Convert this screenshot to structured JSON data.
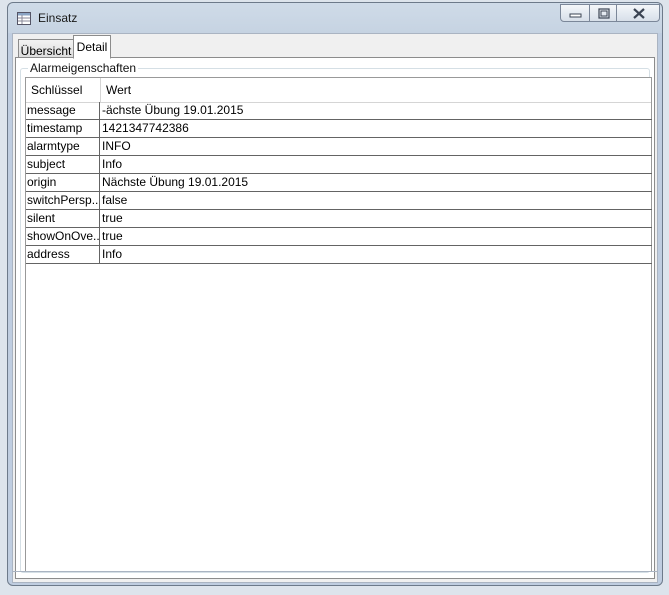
{
  "window": {
    "title": "Einsatz"
  },
  "tabs": [
    {
      "label": "Übersicht"
    },
    {
      "label": "Detail"
    }
  ],
  "group": {
    "label": "Alarmeigenschaften"
  },
  "table": {
    "columns": [
      "Schlüssel",
      "Wert"
    ],
    "rows": [
      {
        "key": "message",
        "value": "-ächste Übung 19.01.2015"
      },
      {
        "key": "timestamp",
        "value": "1421347742386"
      },
      {
        "key": "alarmtype",
        "value": "INFO"
      },
      {
        "key": "subject",
        "value": "Info"
      },
      {
        "key": "origin",
        "value": "Nächste Übung 19.01.2015"
      },
      {
        "key": "switchPersp...",
        "value": "false"
      },
      {
        "key": "silent",
        "value": "true"
      },
      {
        "key": "showOnOve...",
        "value": "true"
      },
      {
        "key": "address",
        "value": "Info"
      }
    ]
  }
}
